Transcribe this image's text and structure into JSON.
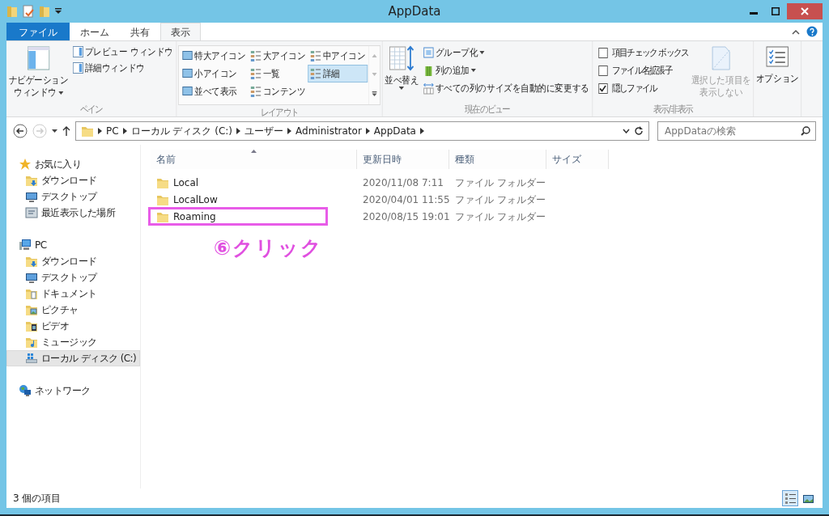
{
  "window": {
    "title": "AppData"
  },
  "ribbon": {
    "tabs": [
      {
        "label": "ファイル",
        "kind": "file",
        "selected": false
      },
      {
        "label": "ホーム",
        "kind": "tab",
        "selected": false
      },
      {
        "label": "共有",
        "kind": "tab",
        "selected": false
      },
      {
        "label": "表示",
        "kind": "tab",
        "selected": true
      }
    ],
    "pane": {
      "label": "ペイン",
      "nav_button": [
        "ナビゲーション",
        "ウィンドウ"
      ],
      "items": [
        "プレビュー ウィンドウ",
        "詳細ウィンドウ"
      ]
    },
    "layout": {
      "label": "レイアウト",
      "options": [
        {
          "label": "特大アイコン",
          "selected": false
        },
        {
          "label": "大アイコン",
          "selected": false
        },
        {
          "label": "中アイコン",
          "selected": false
        },
        {
          "label": "小アイコン",
          "selected": false
        },
        {
          "label": "一覧",
          "selected": false
        },
        {
          "label": "詳細",
          "selected": true
        },
        {
          "label": "並べて表示",
          "selected": false
        },
        {
          "label": "コンテンツ",
          "selected": false
        }
      ]
    },
    "current_view": {
      "label": "現在のビュー",
      "sort_button": "並べ替え",
      "items": [
        {
          "label": "グループ化",
          "dropdown": true
        },
        {
          "label": "列の追加",
          "dropdown": true
        },
        {
          "label": "すべての列のサイズを自動的に変更する",
          "dropdown": false
        }
      ]
    },
    "show_hide": {
      "label": "表示/非表示",
      "checkboxes": [
        {
          "label": "項目チェック ボックス",
          "checked": false
        },
        {
          "label": "ファイル名拡張子",
          "checked": false
        },
        {
          "label": "隠しファイル",
          "checked": true
        }
      ],
      "hide_selected": {
        "label": [
          "選択した項目を",
          "表示しない"
        ],
        "disabled": true
      }
    },
    "options_button": "オプション"
  },
  "address": {
    "path": [
      "PC",
      "ローカル ディスク (C:)",
      "ユーザー",
      "Administrator",
      "AppData"
    ],
    "search": {
      "placeholder": "AppDataの検索"
    }
  },
  "nav_pane": [
    {
      "label": "お気に入り",
      "kind": "star",
      "selected": false,
      "children": [
        {
          "label": "ダウンロード",
          "kind": "download",
          "selected": false
        },
        {
          "label": "デスクトップ",
          "kind": "desktop",
          "selected": false
        },
        {
          "label": "最近表示した場所",
          "kind": "recent",
          "selected": false
        }
      ]
    },
    {
      "label": "PC",
      "kind": "pc",
      "selected": false,
      "children": [
        {
          "label": "ダウンロード",
          "kind": "download",
          "selected": false
        },
        {
          "label": "デスクトップ",
          "kind": "desktop",
          "selected": false
        },
        {
          "label": "ドキュメント",
          "kind": "documents",
          "selected": false
        },
        {
          "label": "ピクチャ",
          "kind": "pictures",
          "selected": false
        },
        {
          "label": "ビデオ",
          "kind": "videos",
          "selected": false
        },
        {
          "label": "ミュージック",
          "kind": "music",
          "selected": false
        },
        {
          "label": "ローカル ディスク (C:)",
          "kind": "drive",
          "selected": true
        }
      ]
    },
    {
      "label": "ネットワーク",
      "kind": "network",
      "selected": false
    }
  ],
  "file_list": {
    "columns": [
      {
        "label": "名前",
        "sorted": true
      },
      {
        "label": "更新日時",
        "sorted": false
      },
      {
        "label": "種類",
        "sorted": false
      },
      {
        "label": "サイズ",
        "sorted": false
      }
    ],
    "rows": [
      {
        "name": "Local",
        "modified": "2020/11/08 7:11",
        "type": "ファイル フォルダー",
        "highlighted": false
      },
      {
        "name": "LocalLow",
        "modified": "2020/04/01 11:55",
        "type": "ファイル フォルダー",
        "highlighted": false
      },
      {
        "name": "Roaming",
        "modified": "2020/08/15 19:01",
        "type": "ファイル フォルダー",
        "highlighted": true
      }
    ]
  },
  "annotation": {
    "text": "⑥クリック"
  },
  "status_bar": {
    "item_count": "3 個の項目",
    "views": [
      {
        "kind": "details",
        "selected": true
      },
      {
        "kind": "large_icons",
        "selected": false
      }
    ]
  }
}
